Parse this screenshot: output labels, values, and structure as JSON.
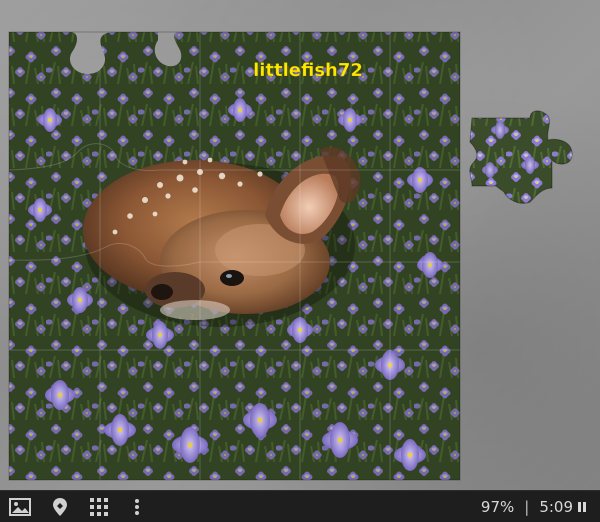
{
  "board": {
    "username": "littlefish72"
  },
  "toolbar": {
    "icons": [
      "image-icon",
      "piece-shape-icon",
      "grid-icon",
      "more-vertical-icon"
    ],
    "progress_label": "97%",
    "progress_value": 97,
    "separator": "|",
    "time": "5:09",
    "timer_icon": "pause-icon"
  },
  "colors": {
    "background": "#8e8e8e",
    "toolbar": "#1e1e1e",
    "toolbar_text": "#d8d8d8",
    "username": "#ffe800",
    "flower": "#9a8ae0",
    "foliage": "#2f4a22"
  }
}
